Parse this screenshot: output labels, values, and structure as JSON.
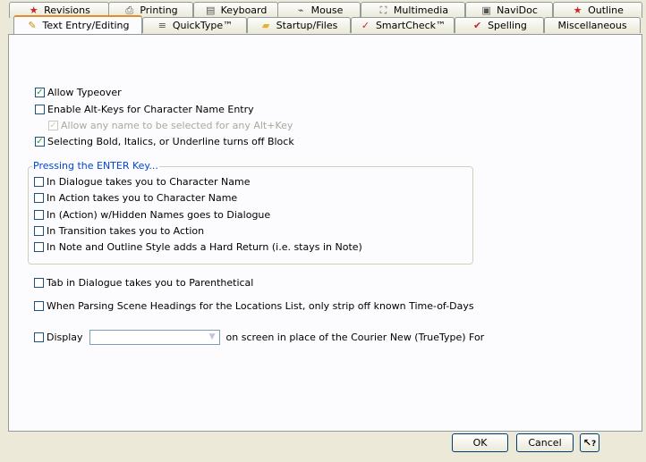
{
  "tabs_back": [
    {
      "label": "Revisions",
      "icon": "star-icon",
      "glyph": "★",
      "color": "#c0282d"
    },
    {
      "label": "Printing",
      "icon": "printer-icon",
      "glyph": "⎙",
      "color": "#555"
    },
    {
      "label": "Keyboard",
      "icon": "keyboard-icon",
      "glyph": "▤",
      "color": "#555"
    },
    {
      "label": "Mouse",
      "icon": "mouse-icon",
      "glyph": "⌁",
      "color": "#555"
    },
    {
      "label": "Multimedia",
      "icon": "multimedia-icon",
      "glyph": "⛶",
      "color": "#555"
    },
    {
      "label": "NaviDoc",
      "icon": "navidoc-icon",
      "glyph": "▣",
      "color": "#555"
    },
    {
      "label": "Outline",
      "icon": "star-icon",
      "glyph": "★",
      "color": "#c0282d"
    }
  ],
  "tabs_front": [
    {
      "label": "Text Entry/Editing",
      "icon": "pencil-icon",
      "glyph": "✎",
      "color": "#c88a10"
    },
    {
      "label": "QuickType™",
      "icon": "quicktype-icon",
      "glyph": "≡",
      "color": "#555"
    },
    {
      "label": "Startup/Files",
      "icon": "folder-icon",
      "glyph": "▰",
      "color": "#e6b22c"
    },
    {
      "label": "SmartCheck™",
      "icon": "smartcheck-icon",
      "glyph": "✓",
      "color": "#c0282d"
    },
    {
      "label": "Spelling",
      "icon": "spelling-icon",
      "glyph": "✔",
      "color": "#c0282d"
    },
    {
      "label": "Miscellaneous",
      "icon": "",
      "glyph": "",
      "color": "#555"
    }
  ],
  "options": {
    "allow_typeover": {
      "label": "Allow Typeover",
      "checked": true
    },
    "enable_alt_keys": {
      "label": "Enable Alt-Keys for Character Name Entry",
      "checked": false
    },
    "allow_any_name": {
      "label": "Allow any name to be selected for any Alt+Key",
      "checked": true,
      "disabled": true
    },
    "bold_italics": {
      "label": "Selecting Bold, Italics, or Underline turns off Block",
      "checked": true
    }
  },
  "enter_group": {
    "title": "Pressing the ENTER Key...",
    "items": [
      {
        "label": "In Dialogue takes you to Character Name",
        "checked": false
      },
      {
        "label": "In Action takes you to Character Name",
        "checked": false
      },
      {
        "label": "In (Action) w/Hidden Names goes to Dialogue",
        "checked": false
      },
      {
        "label": "In Transition takes you to Action",
        "checked": false
      },
      {
        "label": "In Note and Outline Style adds a Hard Return (i.e. stays in Note)",
        "checked": false
      }
    ]
  },
  "more_options": {
    "tab_dialogue": {
      "label": "Tab in Dialogue takes you to Parenthetical",
      "checked": false
    },
    "parse_scene": {
      "label": "When Parsing Scene Headings for the Locations List, only strip off known Time-of-Days",
      "checked": false
    },
    "display": {
      "label": "Display",
      "checked": false,
      "value": "",
      "suffix": "on screen in place of the Courier New (TrueType) For"
    }
  },
  "buttons": {
    "ok": "OK",
    "cancel": "Cancel",
    "help_glyph": "?"
  }
}
